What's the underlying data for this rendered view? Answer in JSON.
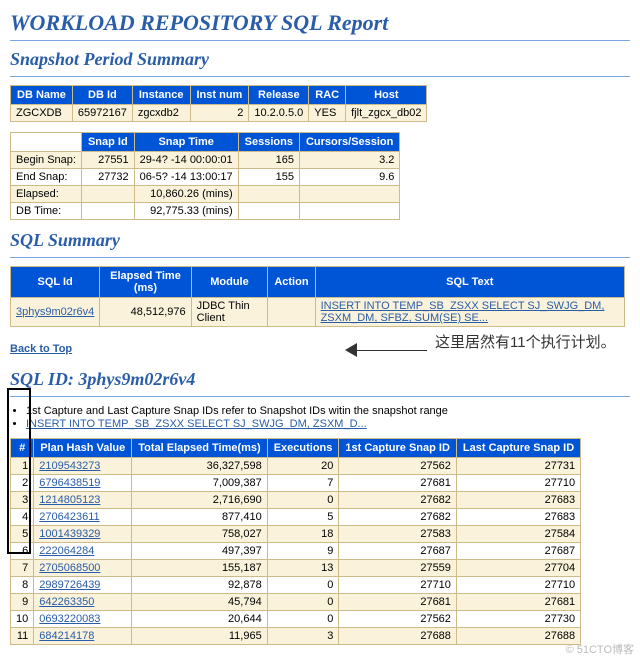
{
  "watermark": "© 51CTO博客",
  "title": "WORKLOAD REPOSITORY SQL Report",
  "sections": {
    "sp": "Snapshot Period Summary",
    "ss": "SQL Summary"
  },
  "back": "Back to Top",
  "dbinfo": {
    "headers": [
      "DB Name",
      "DB Id",
      "Instance",
      "Inst num",
      "Release",
      "RAC",
      "Host"
    ],
    "row": [
      "ZGCXDB",
      "65972167",
      "zgcxdb2",
      "2",
      "10.2.0.5.0",
      "YES",
      "fjlt_zgcx_db02"
    ]
  },
  "snap": {
    "headers": [
      "Snap Id",
      "Snap Time",
      "Sessions",
      "Cursors/Session"
    ],
    "rows": [
      {
        "label": "Begin Snap:",
        "snapid": "27551",
        "time": "29-4? -14 00:00:01",
        "sessions": "165",
        "cursors": "3.2"
      },
      {
        "label": "End Snap:",
        "snapid": "27732",
        "time": "06-5? -14 13:00:17",
        "sessions": "155",
        "cursors": "9.6"
      },
      {
        "label": "Elapsed:",
        "snapid": "",
        "time": "10,860.26 (mins)",
        "sessions": "",
        "cursors": ""
      },
      {
        "label": "DB Time:",
        "snapid": "",
        "time": "92,775.33 (mins)",
        "sessions": "",
        "cursors": ""
      }
    ]
  },
  "sqlsum": {
    "headers": [
      "SQL Id",
      "Elapsed Time (ms)",
      "Module",
      "Action",
      "SQL Text"
    ],
    "row": {
      "id": "3phys9m02r6v4",
      "et": "48,512,976",
      "mod": "JDBC Thin Client",
      "act": "",
      "txt": "INSERT INTO TEMP_SB_ZSXX SELECT SJ_SWJG_DM, ZSXM_DM, SFBZ, SUM(SE) SE..."
    }
  },
  "sqlid": {
    "title": "SQL ID: 3phys9m02r6v4",
    "bullets": [
      "1st Capture and Last Capture Snap IDs refer to Snapshot IDs witin the snapshot range",
      "INSERT INTO TEMP_SB_ZSXX SELECT SJ_SWJG_DM, ZSXM_D..."
    ]
  },
  "annotation": "这里居然有11个执行计划。",
  "plan": {
    "headers": [
      "#",
      "Plan Hash Value",
      "Total Elapsed Time(ms)",
      "Executions",
      "1st Capture Snap ID",
      "Last Capture Snap ID"
    ],
    "rows": [
      [
        "1",
        "2109543273",
        "36,327,598",
        "20",
        "27562",
        "27731"
      ],
      [
        "2",
        "6796438519",
        "7,009,387",
        "7",
        "27681",
        "27710"
      ],
      [
        "3",
        "1214805123",
        "2,716,690",
        "0",
        "27682",
        "27683"
      ],
      [
        "4",
        "2706423611",
        "877,410",
        "5",
        "27682",
        "27683"
      ],
      [
        "5",
        "1001439329",
        "758,027",
        "18",
        "27583",
        "27584"
      ],
      [
        "6",
        "222064284",
        "497,397",
        "9",
        "27687",
        "27687"
      ],
      [
        "7",
        "2705068500",
        "155,187",
        "13",
        "27559",
        "27704"
      ],
      [
        "8",
        "2989726439",
        "92,878",
        "0",
        "27710",
        "27710"
      ],
      [
        "9",
        "642263350",
        "45,794",
        "0",
        "27681",
        "27681"
      ],
      [
        "10",
        "0693220083",
        "20,644",
        "0",
        "27562",
        "27730"
      ],
      [
        "11",
        "684214178",
        "11,965",
        "3",
        "27688",
        "27688"
      ]
    ]
  }
}
